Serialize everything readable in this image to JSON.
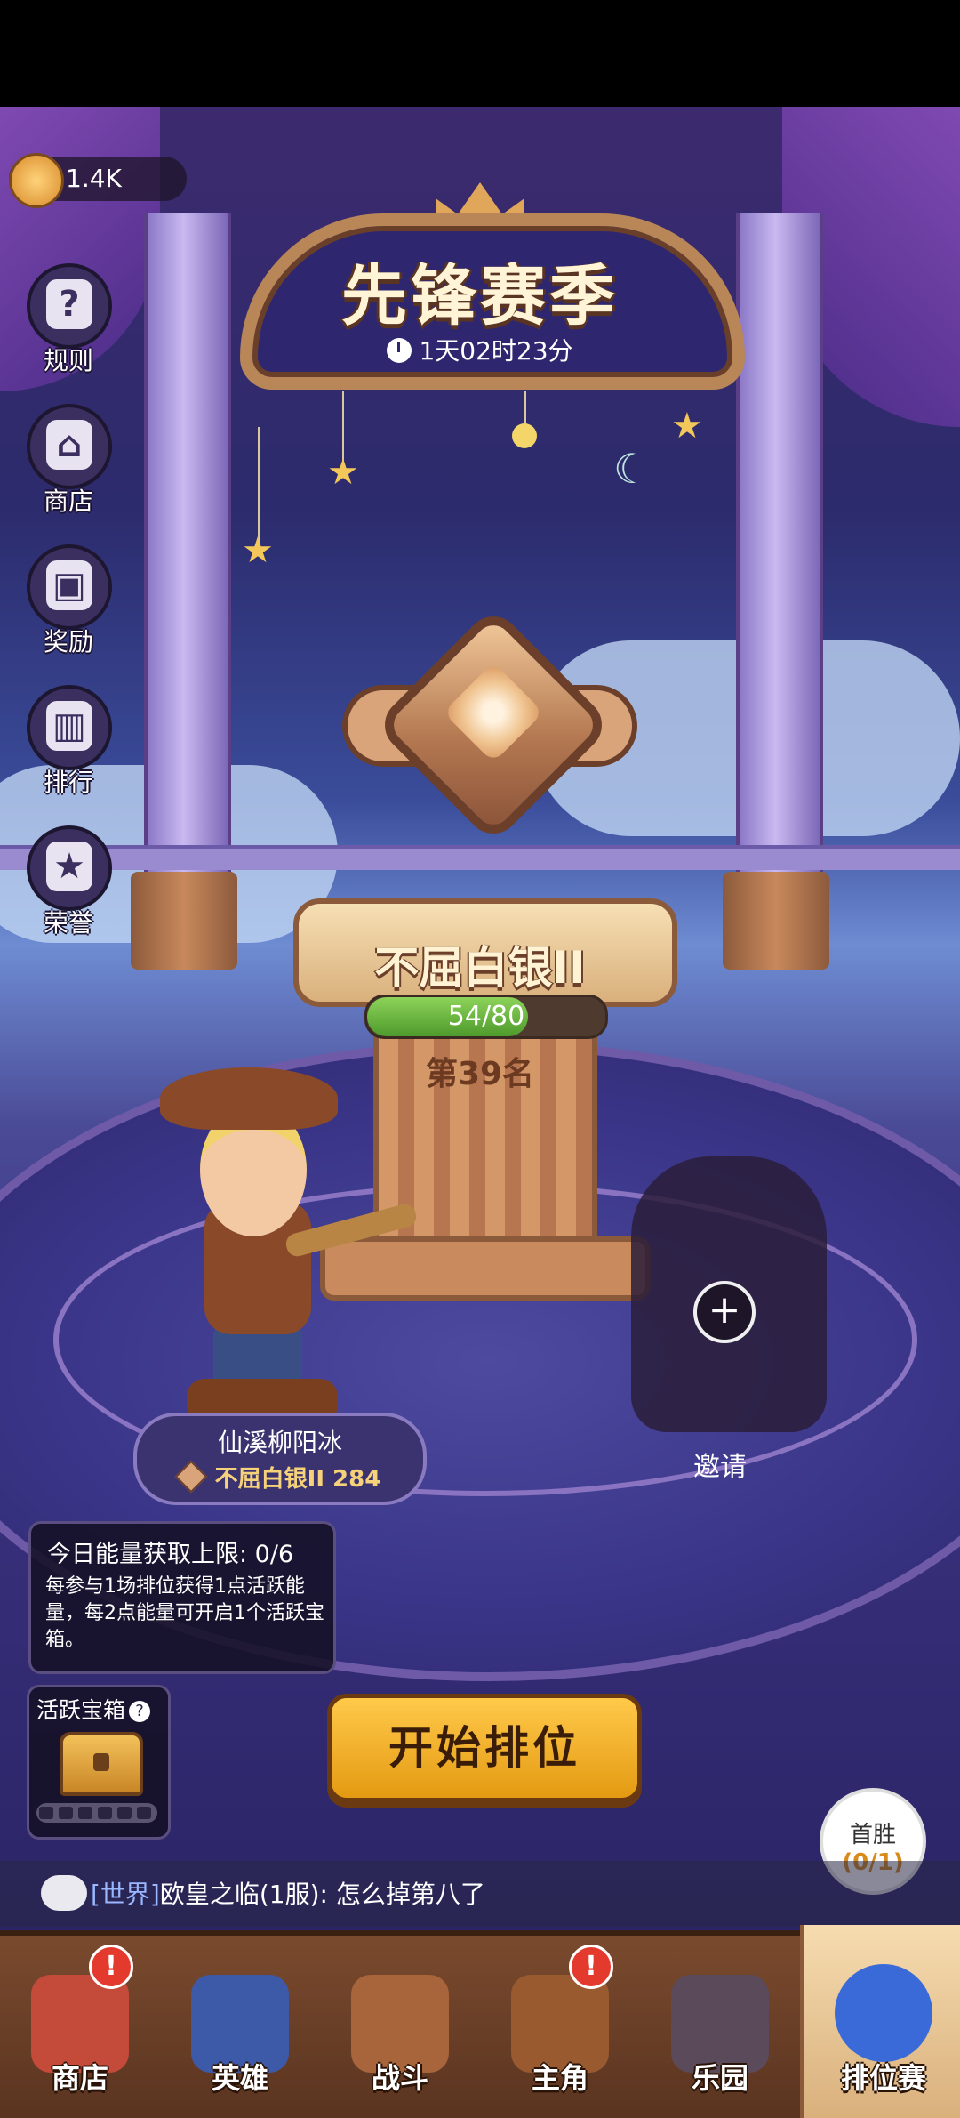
{
  "currency": {
    "amount": "1.4K"
  },
  "season": {
    "title": "先锋赛季",
    "timer": "1天02时23分"
  },
  "side_menu": [
    {
      "label": "规则",
      "icon": "question-icon",
      "glyph": "?"
    },
    {
      "label": "商店",
      "icon": "shop-icon",
      "glyph": "⌂"
    },
    {
      "label": "奖励",
      "icon": "chest-icon",
      "glyph": "▣"
    },
    {
      "label": "排行",
      "icon": "bar-chart-icon",
      "glyph": "▥"
    },
    {
      "label": "荣誉",
      "icon": "medal-icon",
      "glyph": "★"
    }
  ],
  "rank": {
    "name": "不屈白银II",
    "progress_text": "54/80",
    "progress": 0.675,
    "position": "第39名"
  },
  "player": {
    "name": "仙溪柳阳冰",
    "rank_text": "不屈白银II 284"
  },
  "invite": {
    "label": "邀请",
    "plus": "+"
  },
  "energy": {
    "title": "今日能量获取上限: 0/6",
    "description": "每参与1场排位获得1点活跃能量，每2点能量可开启1个活跃宝箱。"
  },
  "chest": {
    "title": "活跃宝箱",
    "help": "?"
  },
  "start_button": {
    "label": "开始排位"
  },
  "first_win": {
    "label": "首胜",
    "count": "(0/1)"
  },
  "chat": {
    "channel": "[世界]",
    "message": "欧皇之临(1服): 怎么掉第八了"
  },
  "nav": [
    {
      "label": "商店",
      "badge": "!",
      "icon": "shop-icon",
      "color": "#c44a3a"
    },
    {
      "label": "英雄",
      "badge": "",
      "icon": "cards-icon",
      "color": "#3d5aa8"
    },
    {
      "label": "战斗",
      "badge": "",
      "icon": "swords-icon",
      "color": "#a8643a"
    },
    {
      "label": "主角",
      "badge": "!",
      "icon": "owl-icon",
      "color": "#9a5a30"
    },
    {
      "label": "乐园",
      "badge": "",
      "icon": "locked-castle-icon",
      "color": "#5a4a5a"
    },
    {
      "label": "排位赛",
      "badge": "",
      "icon": "ranked-emblem-icon",
      "color": "#3a6ad8"
    }
  ]
}
